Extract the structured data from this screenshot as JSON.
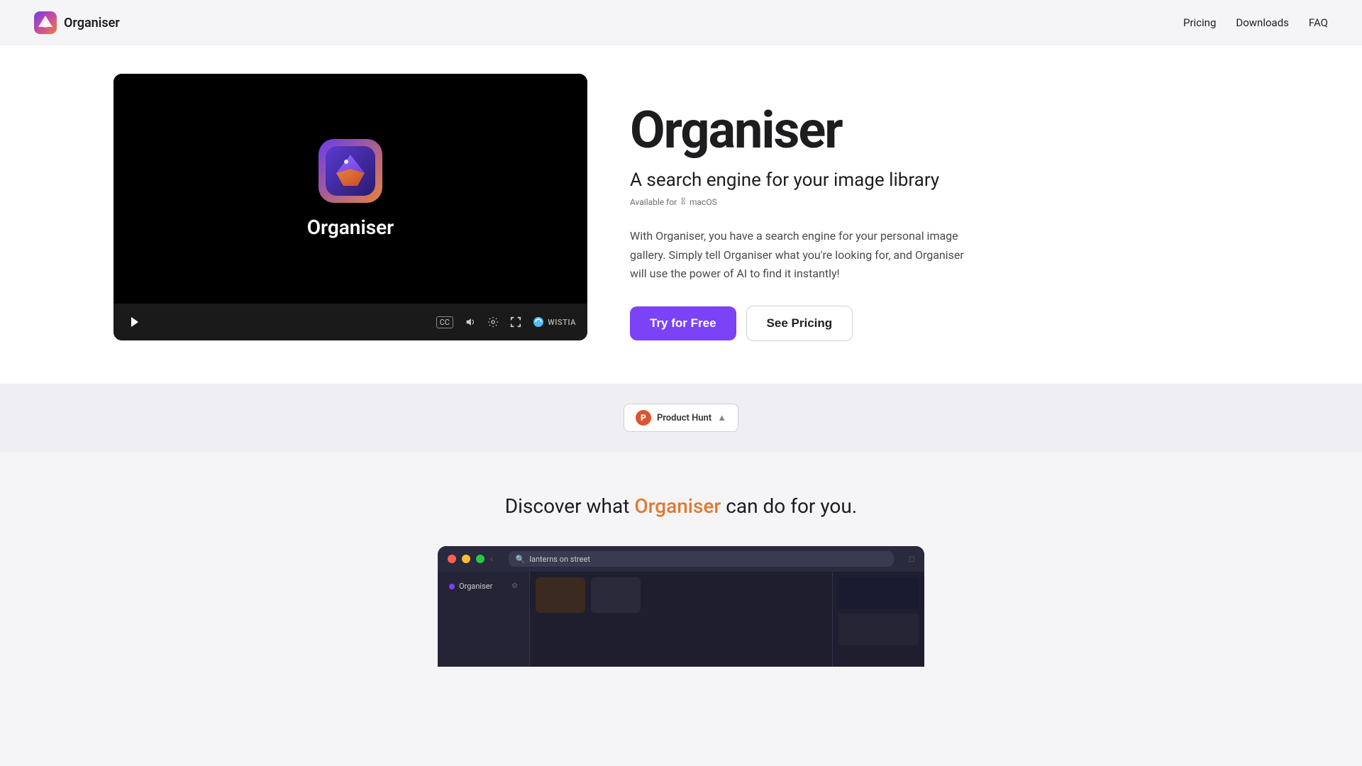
{
  "nav": {
    "brand": "Organiser",
    "links": [
      {
        "label": "Pricing",
        "href": "#"
      },
      {
        "label": "Downloads",
        "href": "#"
      },
      {
        "label": "FAQ",
        "href": "#"
      }
    ]
  },
  "hero": {
    "title": "Organiser",
    "subtitle": "A search engine for your image library",
    "available": "Available for",
    "platform": "macOS",
    "description": "With Organiser, you have a search engine for your personal image gallery. Simply tell Organiser what you're looking for, and Organiser will use the power of AI to find it instantly!",
    "cta_primary": "Try for Free",
    "cta_secondary": "See Pricing"
  },
  "video": {
    "app_name": "Organiser",
    "controls": {
      "cc": "CC",
      "volume": "🔊",
      "settings": "⚙",
      "fullscreen": "⛶",
      "wistia": "WISTIA"
    }
  },
  "product_hunt": {
    "label": "Product Hunt",
    "arrow": "▲"
  },
  "discover": {
    "prefix": "Discover what ",
    "brand": "Organiser",
    "suffix": " can do for you."
  },
  "app_demo": {
    "search_placeholder": "lanterns on street",
    "sidebar_item": "Organiser"
  },
  "colors": {
    "brand_orange": "#e07a2f",
    "brand_purple": "#7b42f6",
    "accent": "#da552f"
  }
}
